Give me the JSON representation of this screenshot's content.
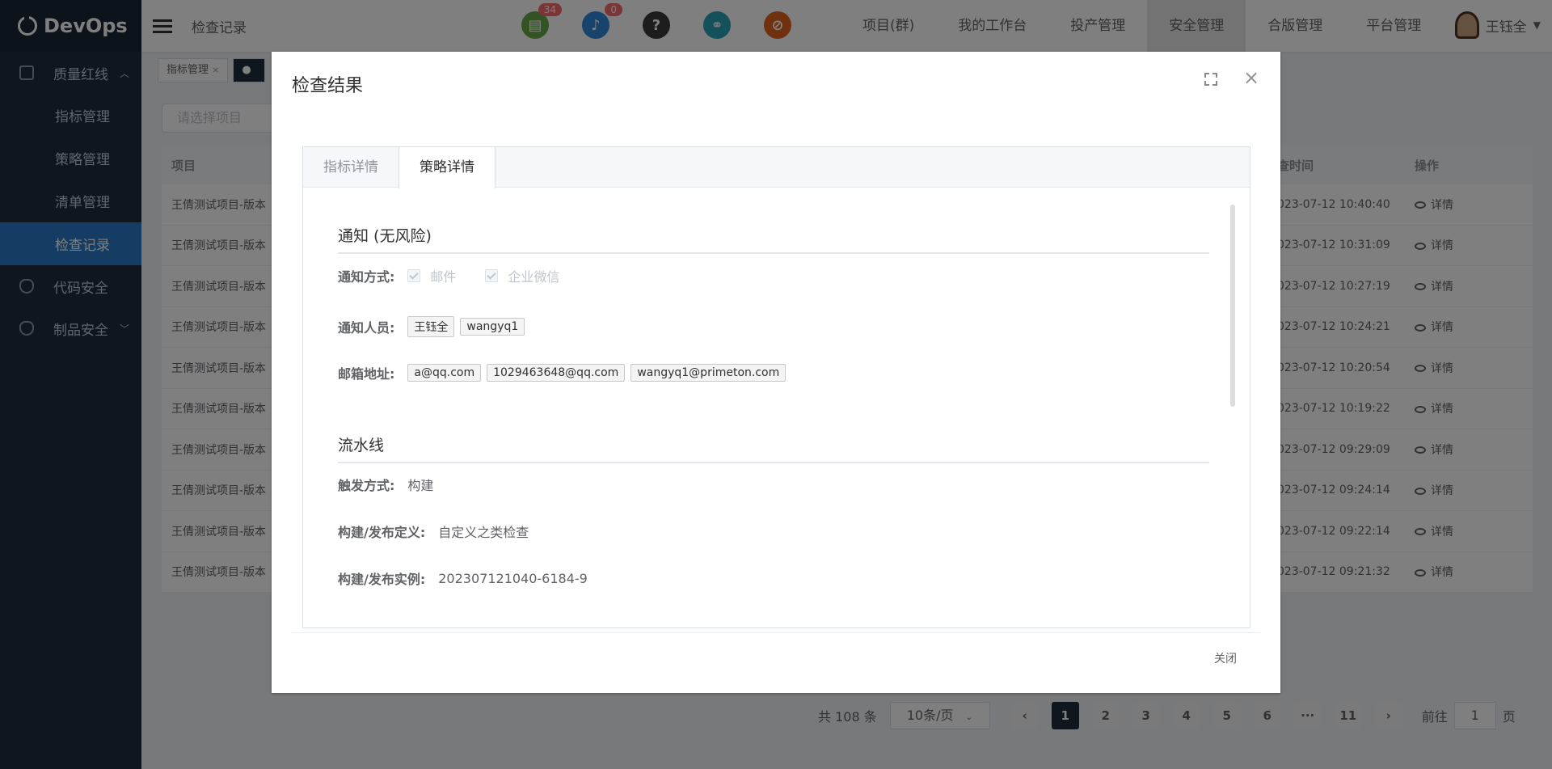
{
  "app": {
    "name": "DevOps"
  },
  "sidebar": {
    "group1": "质量红线",
    "sub": [
      "指标管理",
      "策略管理",
      "清单管理",
      "检查记录"
    ],
    "group2": "代码安全",
    "group3": "制品安全"
  },
  "header": {
    "breadcrumb": "检查记录",
    "badge_tasks": "34",
    "badge_notice": "0",
    "nav": [
      "项目(群)",
      "我的工作台",
      "投产管理",
      "安全管理",
      "合版管理",
      "平台管理"
    ],
    "user": "王钰全"
  },
  "tagsview": {
    "tag1": "指标管理"
  },
  "filter": {
    "placeholder": "请选择项目"
  },
  "table": {
    "headers": [
      "项目",
      "查时间",
      "操作"
    ],
    "rows": [
      {
        "project": "王倩测试项目-版本",
        "time": "023-07-12 10:40:40",
        "op": "详情"
      },
      {
        "project": "王倩测试项目-版本",
        "time": "023-07-12 10:31:09",
        "op": "详情"
      },
      {
        "project": "王倩测试项目-版本",
        "time": "023-07-12 10:27:19",
        "op": "详情"
      },
      {
        "project": "王倩测试项目-版本",
        "time": "023-07-12 10:24:21",
        "op": "详情"
      },
      {
        "project": "王倩测试项目-版本",
        "time": "023-07-12 10:20:54",
        "op": "详情"
      },
      {
        "project": "王倩测试项目-版本",
        "time": "023-07-12 10:19:22",
        "op": "详情"
      },
      {
        "project": "王倩测试项目-版本",
        "time": "023-07-12 09:29:09",
        "op": "详情"
      },
      {
        "project": "王倩测试项目-版本",
        "time": "023-07-12 09:24:14",
        "op": "详情"
      },
      {
        "project": "王倩测试项目-版本",
        "time": "023-07-12 09:22:14",
        "op": "详情"
      },
      {
        "project": "王倩测试项目-版本",
        "time": "023-07-12 09:21:32",
        "op": "详情"
      }
    ]
  },
  "pager": {
    "total": "共 108 条",
    "size": "10条/页",
    "pages": [
      "1",
      "2",
      "3",
      "4",
      "5",
      "6",
      "···",
      "11"
    ],
    "goto": "前往",
    "goto_value": "1",
    "page_unit": "页"
  },
  "dialog": {
    "title": "检查结果",
    "tabs": [
      "指标详情",
      "策略详情"
    ],
    "notify_title": "通知 (无风险)",
    "notify_method_label": "通知方式:",
    "method_options": [
      "邮件",
      "企业微信"
    ],
    "notify_people_label": "通知人员:",
    "people": [
      "王钰全",
      "wangyq1"
    ],
    "email_label": "邮箱地址:",
    "emails": [
      "a@qq.com",
      "1029463648@qq.com",
      "wangyq1@primeton.com"
    ],
    "pipeline_title": "流水线",
    "trigger_label": "触发方式:",
    "trigger_value": "构建",
    "build_def_label": "构建/发布定义:",
    "build_def_value": "自定义之类检查",
    "build_inst_label": "构建/发布实例:",
    "build_inst_value": "202307121040-6184-9",
    "close_button": "关闭"
  }
}
